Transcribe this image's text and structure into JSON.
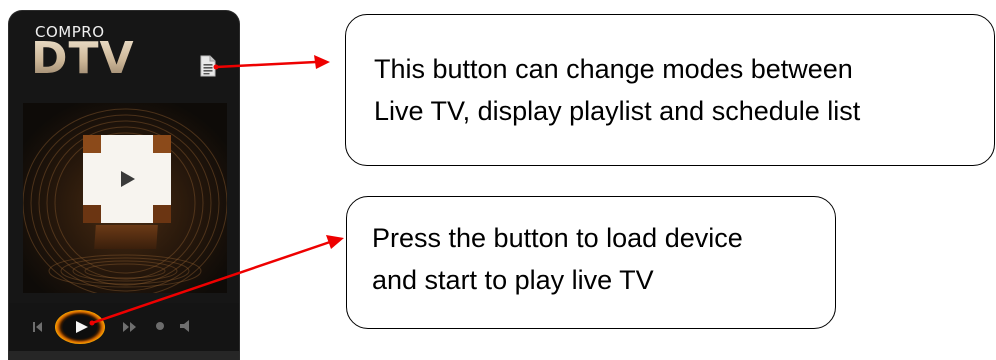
{
  "player": {
    "brand_small": "COMPRO",
    "brand_big": "DTV",
    "mode_button_icon": "document-icon",
    "center_button_icon": "play-icon",
    "controls": [
      {
        "name": "previous",
        "icon": "skip-previous-icon"
      },
      {
        "name": "play",
        "icon": "play-icon"
      },
      {
        "name": "fast-forward",
        "icon": "fast-forward-icon"
      },
      {
        "name": "record",
        "icon": "record-icon"
      },
      {
        "name": "volume",
        "icon": "speaker-icon"
      }
    ],
    "accent_color": "#ff9a00",
    "panel_color": "#161616"
  },
  "callouts": [
    {
      "line1": "This button can change modes between",
      "line2": "Live TV, display playlist and schedule list"
    },
    {
      "line1": "Press the button to load device",
      "line2": "and start to play live TV"
    }
  ],
  "arrow_color": "#ee0000"
}
